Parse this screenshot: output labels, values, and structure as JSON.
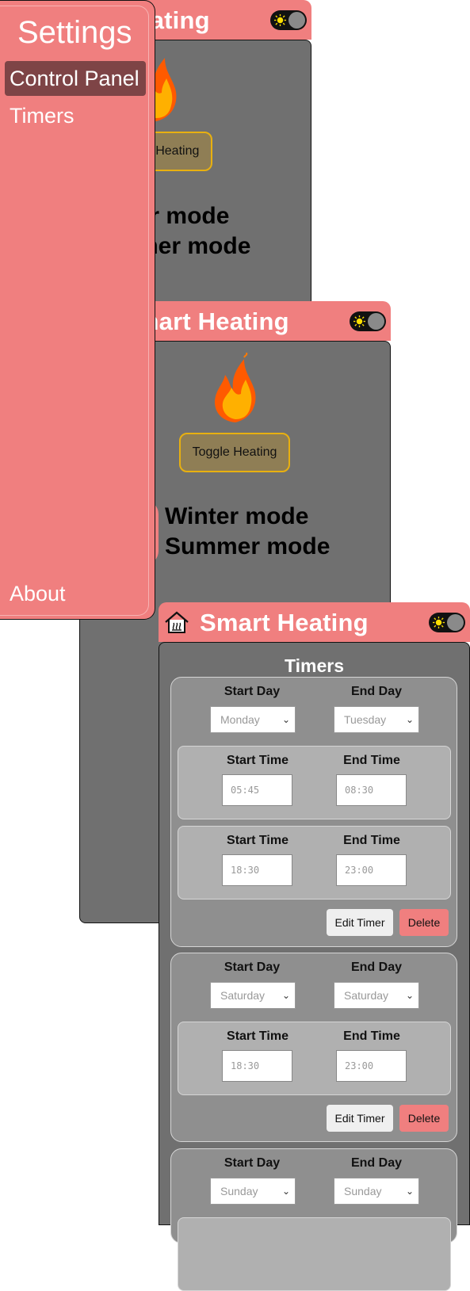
{
  "app": {
    "title": "Smart Heating",
    "toggle_label": "Toggle Heating",
    "mode_winter": "Winter mode",
    "mode_summer": "Summer mode"
  },
  "sidebar": {
    "title": "Settings",
    "items": [
      {
        "label": "Control Panel",
        "active": true
      },
      {
        "label": "Timers",
        "active": false
      }
    ],
    "footer_item": "About"
  },
  "timers": {
    "heading": "Timers",
    "labels": {
      "start_day": "Start Day",
      "end_day": "End Day",
      "start_time": "Start Time",
      "end_time": "End Time",
      "edit": "Edit Timer",
      "delete": "Delete"
    },
    "items": [
      {
        "start_day": "Monday",
        "end_day": "Tuesday",
        "ranges": [
          {
            "start": "05:45",
            "end": "08:30"
          },
          {
            "start": "18:30",
            "end": "23:00"
          }
        ]
      },
      {
        "start_day": "Saturday",
        "end_day": "Saturday",
        "ranges": [
          {
            "start": "18:30",
            "end": "23:00"
          }
        ]
      },
      {
        "start_day": "Sunday",
        "end_day": "Sunday",
        "ranges": []
      }
    ]
  },
  "colors": {
    "accent": "#f07f7f",
    "panel": "#707070",
    "active_item": "#7e4446",
    "toggle_border": "#e8b010"
  },
  "icons": [
    "home-icon",
    "sun-icon",
    "flame-icon",
    "chevron-down-icon"
  ]
}
